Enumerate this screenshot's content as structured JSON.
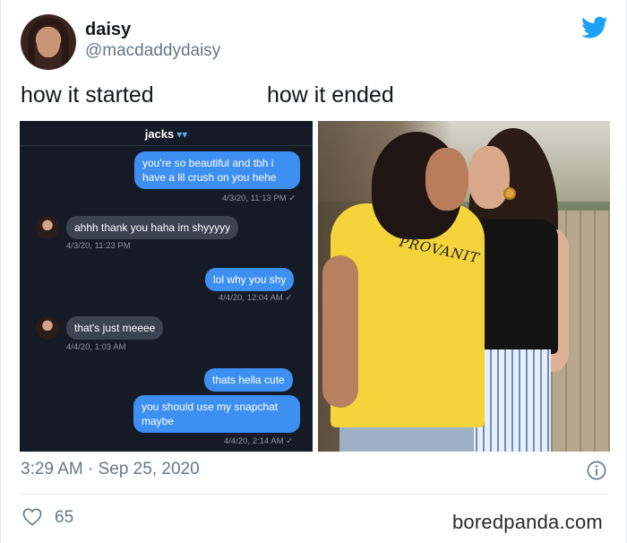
{
  "tweet": {
    "display_name": "daisy",
    "handle": "@macdaddydaisy",
    "caption_left": "how it started",
    "caption_right": "how it ended",
    "timestamp": "3:29 AM · Sep 25, 2020",
    "like_count": "65",
    "brand_color": "#1da1f2"
  },
  "chat": {
    "title": "jacks",
    "title_icon": "butterfly-icon",
    "messages": [
      {
        "from": "me",
        "text": "you're so beautiful and tbh i have a lil crush on you hehe",
        "time": "4/3/20, 11:13 PM ✓"
      },
      {
        "from": "them",
        "text": "ahhh thank you haha im shyyyyy",
        "time": "4/3/20, 11:23 PM"
      },
      {
        "from": "me",
        "text": "lol why you shy",
        "time": "4/4/20, 12:04 AM ✓"
      },
      {
        "from": "them",
        "text": "that's just meeee",
        "time": "4/4/20, 1:03 AM"
      },
      {
        "from": "me",
        "text": "thats hella cute",
        "time": ""
      },
      {
        "from": "me",
        "text": "you should use my snapchat maybe",
        "time": "4/4/20, 2:14 AM ✓"
      }
    ]
  },
  "photo": {
    "shirt_text": "PROVANIT"
  },
  "watermark": "boredpanda.com"
}
